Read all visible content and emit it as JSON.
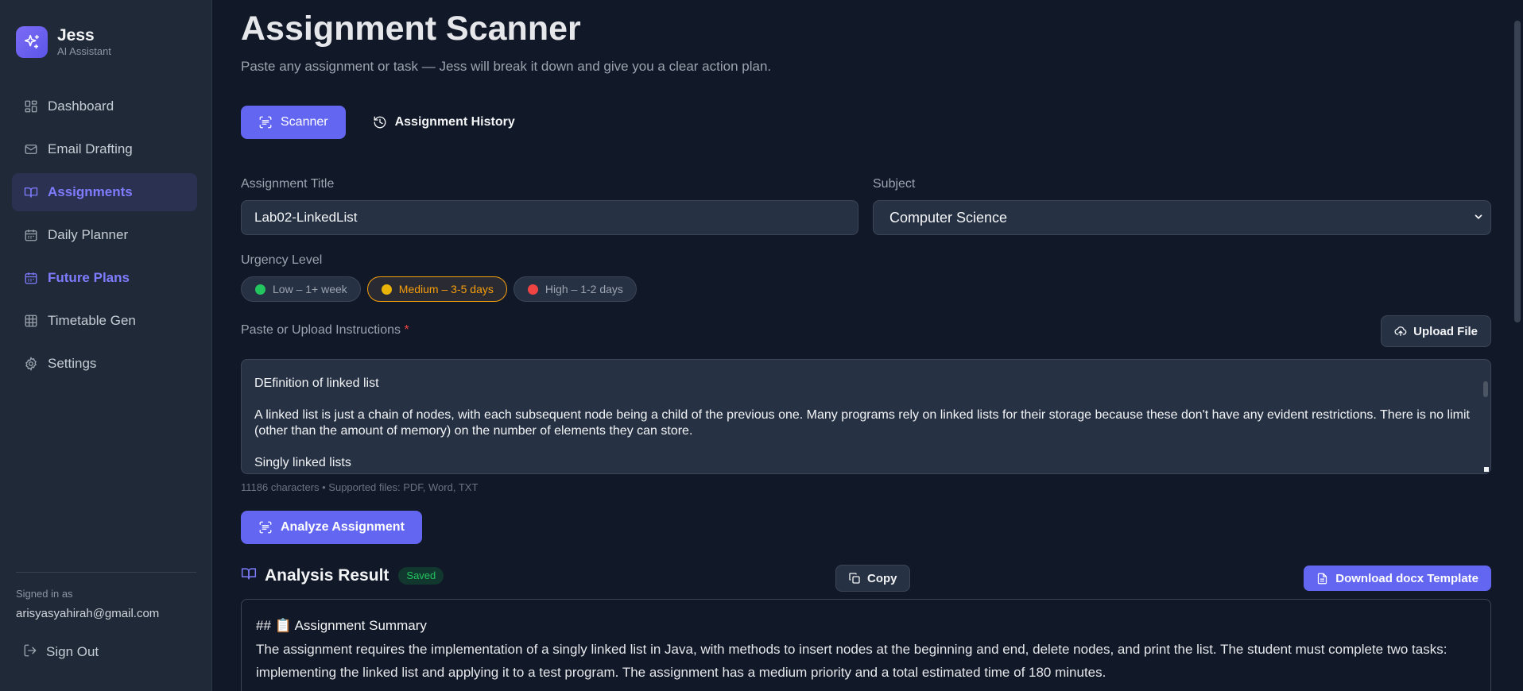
{
  "brand": {
    "name": "Jess",
    "subtitle": "AI Assistant",
    "logo_icon": "sparkles-icon"
  },
  "sidebar": {
    "items": [
      {
        "label": "Dashboard",
        "icon": "dashboard-icon"
      },
      {
        "label": "Email Drafting",
        "icon": "mail-icon"
      },
      {
        "label": "Assignments",
        "icon": "book-open-icon",
        "active": true
      },
      {
        "label": "Daily Planner",
        "icon": "calendar-icon"
      },
      {
        "label": "Future Plans",
        "icon": "calendar-icon"
      },
      {
        "label": "Timetable Gen",
        "icon": "grid-icon"
      },
      {
        "label": "Settings",
        "icon": "gear-icon"
      }
    ],
    "signed_in_label": "Signed in as",
    "email": "arisyasyahirah@gmail.com",
    "sign_out": "Sign Out"
  },
  "page": {
    "title": "Assignment Scanner",
    "subtitle": "Paste any assignment or task — Jess will break it down and give you a clear action plan."
  },
  "tabs": {
    "scanner": "Scanner",
    "history": "Assignment History"
  },
  "form": {
    "title_label": "Assignment Title",
    "title_value": "Lab02-LinkedList",
    "subject_label": "Subject",
    "subject_value": "Computer Science",
    "urgency_label": "Urgency Level",
    "urgency": [
      {
        "label": "Low – 1+ week",
        "color": "#22c55e"
      },
      {
        "label": "Medium – 3-5 days",
        "color": "#eab308",
        "selected": true
      },
      {
        "label": "High – 1-2 days",
        "color": "#ef4444"
      }
    ],
    "instructions_label": "Paste or Upload Instructions",
    "required_mark": "*",
    "upload_button": "Upload File",
    "instructions_lines": [
      "DEfinition of linked list",
      "A linked list is just a chain of nodes, with each subsequent node being a child of the previous one. Many programs rely on linked lists for their storage because these don't have any evident restrictions. There is no limit (other than the amount of memory) on the number of elements they can store.",
      "Singly linked lists"
    ],
    "char_info": "11186 characters • Supported files: PDF, Word, TXT",
    "analyze_button": "Analyze Assignment"
  },
  "result": {
    "title": "Analysis Result",
    "badge": "Saved",
    "copy_button": "Copy",
    "download_button": "Download docx Template",
    "heading": "## 📋 Assignment Summary",
    "summary": "The assignment requires the implementation of a singly linked list in Java, with methods to insert nodes at the beginning and end, delete nodes, and print the list. The student must complete two tasks: implementing the linked list and applying it to a test program. The assignment has a medium priority and a total estimated time of 180 minutes."
  },
  "colors": {
    "accent": "#6366f1",
    "accent_text": "#7f7cff",
    "warning": "#f59e0b",
    "success": "#22c55e"
  }
}
